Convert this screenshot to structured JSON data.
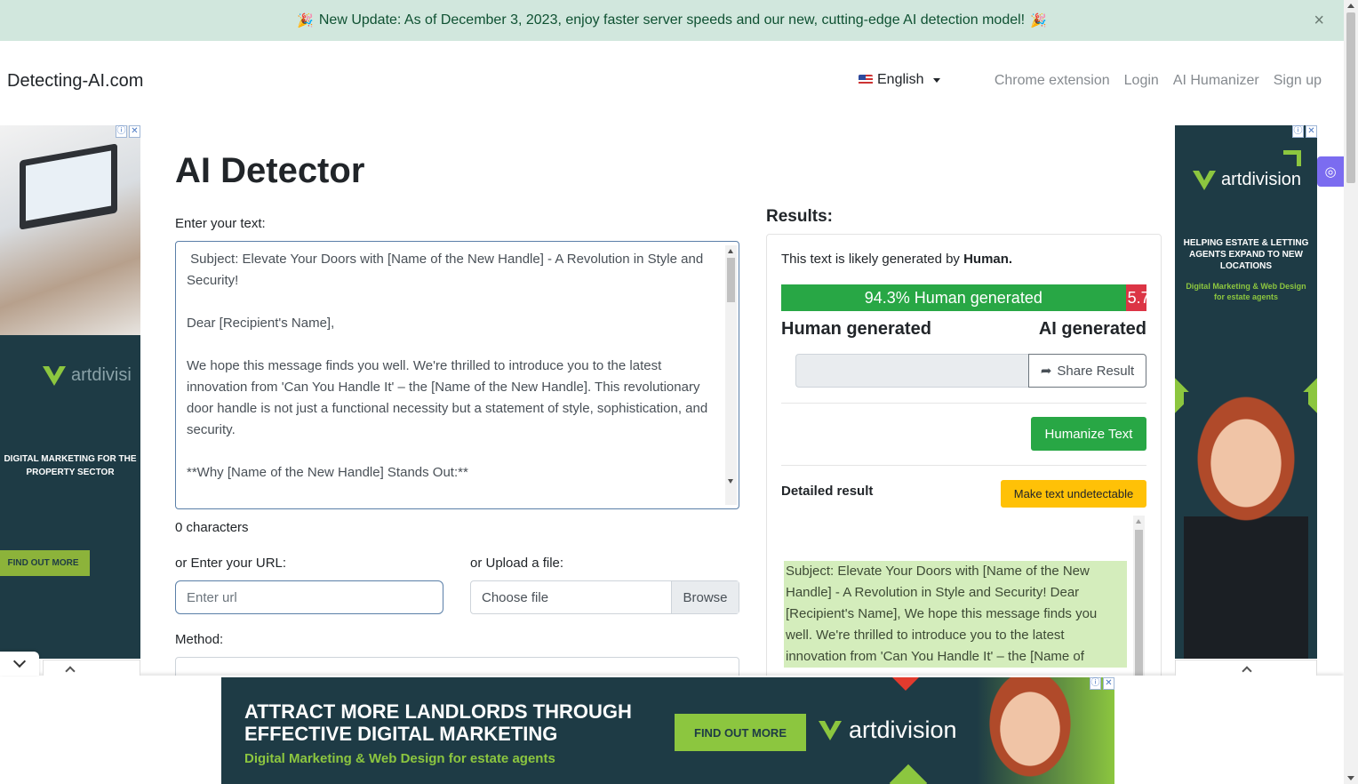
{
  "announcement": {
    "icon": "party-popper-icon",
    "text": "New Update: As of December 3, 2023, enjoy faster server speeds and our new, cutting-edge AI detection model!"
  },
  "navbar": {
    "brand": "Detecting-AI.com",
    "language": "English",
    "links": [
      "Chrome extension",
      "Login",
      "AI Humanizer",
      "Sign up"
    ]
  },
  "main": {
    "title": "AI Detector",
    "text_label": "Enter your text:",
    "text_value": " Subject: Elevate Your Doors with [Name of the New Handle] - A Revolution in Style and Security!\n\nDear [Recipient's Name],\n\nWe hope this message finds you well. We're thrilled to introduce you to the latest innovation from 'Can You Handle It' – the [Name of the New Handle]. This revolutionary door handle is not just a functional necessity but a statement of style, sophistication, and security.\n\n**Why [Name of the New Handle] Stands Out:**",
    "char_count": "0 characters",
    "url_label": "or Enter your URL:",
    "url_placeholder": "Enter url",
    "file_label": "or Upload a file:",
    "file_placeholder": "Choose file",
    "browse_label": "Browse",
    "method_label": "Method:"
  },
  "results": {
    "title": "Results:",
    "verdict_prefix": "This text is likely generated by ",
    "verdict_value": "Human.",
    "human_percent": 94.3,
    "ai_percent": 5.7,
    "human_bar_label": "94.3% Human generated",
    "ai_bar_label": "5.7",
    "human_axis_label": "Human generated",
    "ai_axis_label": "AI generated",
    "share_label": "Share Result",
    "humanize_label": "Humanize Text",
    "detailed_label": "Detailed result",
    "undetectable_label": "Make text undetectable",
    "detailed_text": "Subject: Elevate Your Doors with [Name of the New Handle] - A Revolution in Style and Security! Dear [Recipient's Name], We hope this message finds you well. We're thrilled to introduce you to the latest innovation from 'Can You Handle It' – the [Name of"
  },
  "ads": {
    "left_logo": "artdivisi",
    "left_headline": "DIGITAL MARKETING FOR THE PROPERTY SECTOR",
    "left_cta": "FIND OUT MORE",
    "right_logo": "artdivision",
    "right_headline": "HELPING ESTATE & LETTING AGENTS EXPAND TO NEW LOCATIONS",
    "right_sub": "Digital Marketing & Web Design for estate agents",
    "bottom_headline_1": "ATTRACT MORE LANDLORDS THROUGH",
    "bottom_headline_2": "EFFECTIVE DIGITAL MARKETING",
    "bottom_sub": "Digital Marketing & Web Design for estate agents",
    "bottom_cta": "FIND OUT MORE",
    "bottom_logo": "artdivision",
    "info_icon": "ⓘ",
    "close_icon": "✕"
  },
  "colors": {
    "announce_bg": "#d1e7dd",
    "success": "#28a745",
    "danger": "#dc3545",
    "warning": "#ffc107",
    "ad_navy": "#1e3b45",
    "ad_green": "#8cc63f"
  }
}
